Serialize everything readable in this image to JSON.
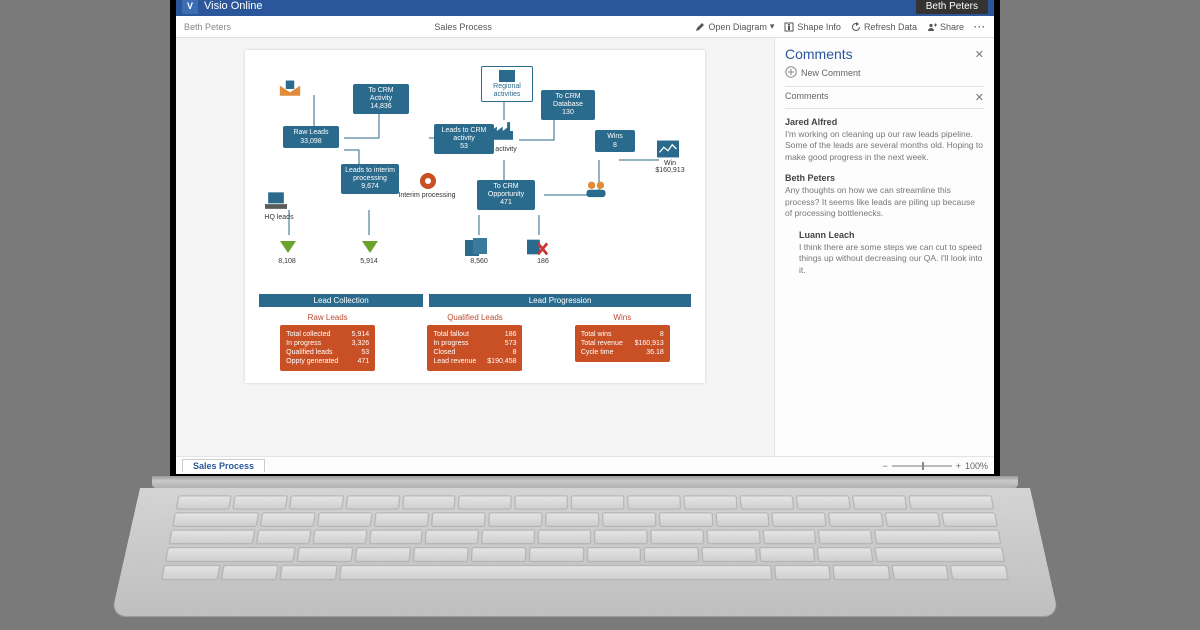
{
  "app": {
    "name": "Visio Online",
    "user": "Beth Peters"
  },
  "breadcrumb": "Beth Peters",
  "document_title": "Sales Process",
  "toolbar": {
    "open": "Open Diagram",
    "shape": "Shape Info",
    "refresh": "Refresh Data",
    "share": "Share"
  },
  "diagram": {
    "nodes": {
      "to_crm_activity": {
        "label": "To CRM Activity",
        "value": "14,836"
      },
      "raw_leads": {
        "label": "Raw Leads",
        "value": "33,098"
      },
      "leads_to_crm_activity": {
        "label": "Leads to CRM activity",
        "value": "53"
      },
      "leads_to_interim": {
        "label": "Leads to interim processing",
        "value": "9,674"
      },
      "regional_activities": "Regional activities",
      "to_crm_database": {
        "label": "To CRM Database",
        "value": "130"
      },
      "to_crm_opportunity": {
        "label": "To CRM Opportunity",
        "value": "471"
      },
      "wins": {
        "label": "Wins",
        "value": "8"
      },
      "win_amount": {
        "label": "Win",
        "value": "$160,913"
      },
      "hq_leads": "HQ leads",
      "activity": "activity",
      "interim_processing": "Interim processing"
    },
    "panel_values": {
      "a": "8,108",
      "b": "5,914",
      "c": "8,560",
      "d": "186"
    },
    "bands": {
      "left": "Lead Collection",
      "right": "Lead Progression"
    },
    "cards": {
      "raw": {
        "title": "Raw Leads",
        "rows": [
          {
            "k": "Total collected",
            "v": "5,914"
          },
          {
            "k": "In progress",
            "v": "3,326"
          },
          {
            "k": "Qualified leads",
            "v": "53"
          },
          {
            "k": "Oppty generated",
            "v": "471"
          }
        ]
      },
      "qualified": {
        "title": "Qualified Leads",
        "rows": [
          {
            "k": "Total fallout",
            "v": "186"
          },
          {
            "k": "In progress",
            "v": "573"
          },
          {
            "k": "Closed",
            "v": "8"
          },
          {
            "k": "Lead revenue",
            "v": "$190,458"
          }
        ]
      },
      "wins": {
        "title": "Wins",
        "rows": [
          {
            "k": "Total wins",
            "v": "8"
          },
          {
            "k": "Total revenue",
            "v": "$160,913"
          },
          {
            "k": "Cycle time",
            "v": "36.18"
          }
        ]
      }
    }
  },
  "comments_panel": {
    "title": "Comments",
    "new_label": "New Comment",
    "section": "Comments",
    "items": [
      {
        "author": "Jared Alfred",
        "body": "I'm working on cleaning up our raw leads pipeline. Some of the leads are several months old. Hoping to make good progress in the next week.",
        "reply": false
      },
      {
        "author": "Beth Peters",
        "body": "Any thoughts on how we can streamline this process? It seems like leads are piling up because of processing bottlenecks.",
        "reply": false
      },
      {
        "author": "Luann Leach",
        "body": "I think there are some steps we can cut to speed things up without decreasing our QA. I'll look into it.",
        "reply": true
      }
    ]
  },
  "status": {
    "sheet": "Sales Process",
    "zoom": "100%"
  }
}
